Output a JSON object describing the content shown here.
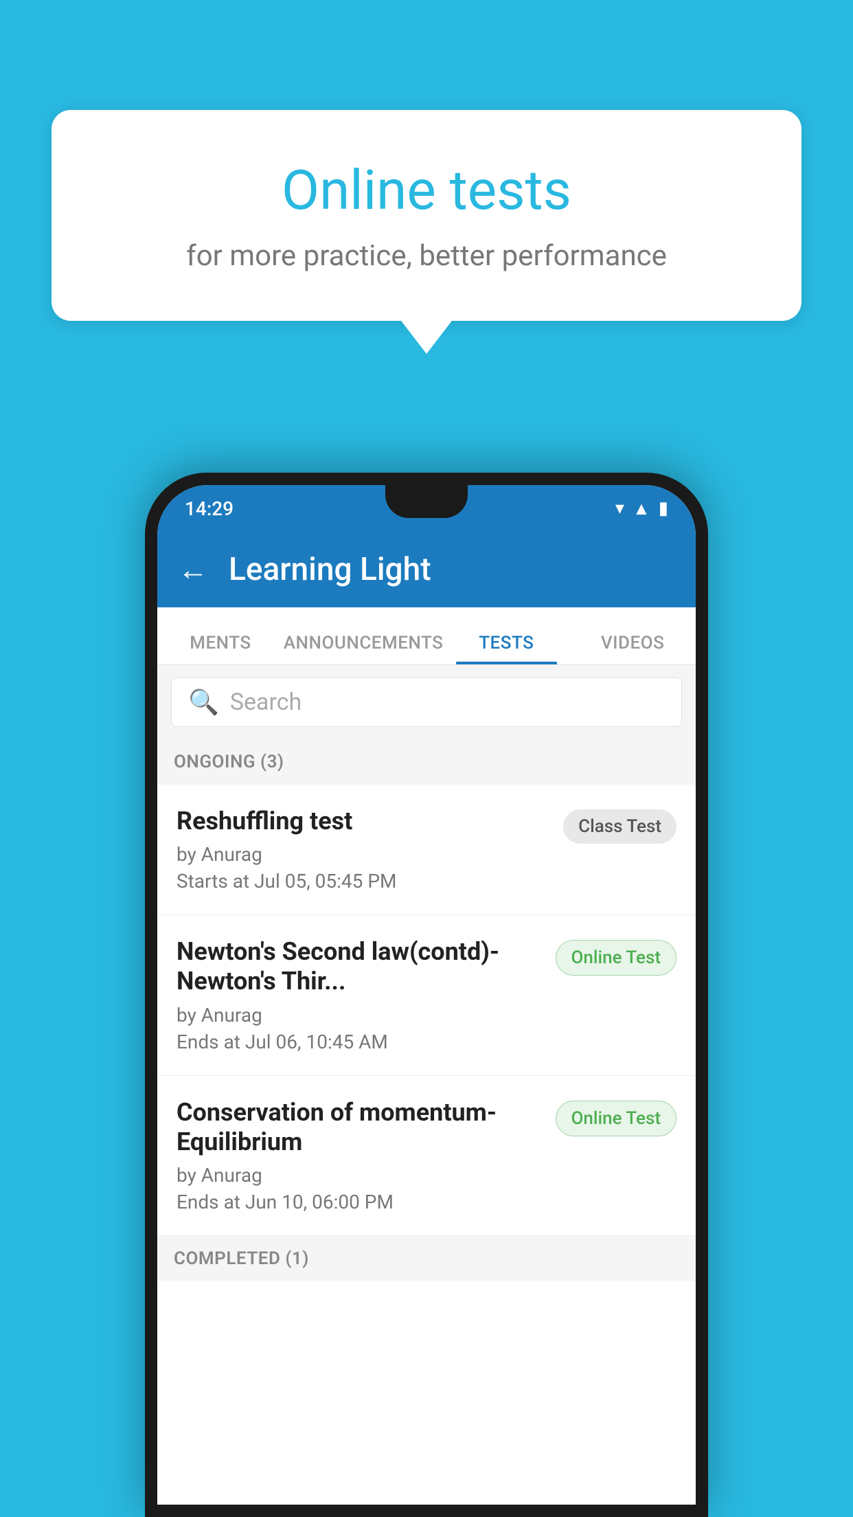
{
  "background_color": "#29b8e0",
  "bubble": {
    "title": "Online tests",
    "subtitle": "for more practice, better performance"
  },
  "phone": {
    "status_bar": {
      "time": "14:29",
      "icons": [
        "wifi",
        "signal",
        "battery"
      ]
    },
    "app_bar": {
      "title": "Learning Light",
      "back_label": "←"
    },
    "tabs": [
      {
        "label": "MENTS",
        "active": false
      },
      {
        "label": "ANNOUNCEMENTS",
        "active": false
      },
      {
        "label": "TESTS",
        "active": true
      },
      {
        "label": "VIDEOS",
        "active": false
      }
    ],
    "search": {
      "placeholder": "Search"
    },
    "sections": [
      {
        "header": "ONGOING (3)",
        "items": [
          {
            "name": "Reshuffling test",
            "by": "by Anurag",
            "time": "Starts at  Jul 05, 05:45 PM",
            "badge": "Class Test",
            "badge_type": "class"
          },
          {
            "name": "Newton's Second law(contd)-Newton's Thir...",
            "by": "by Anurag",
            "time": "Ends at  Jul 06, 10:45 AM",
            "badge": "Online Test",
            "badge_type": "online"
          },
          {
            "name": "Conservation of momentum-Equilibrium",
            "by": "by Anurag",
            "time": "Ends at  Jun 10, 06:00 PM",
            "badge": "Online Test",
            "badge_type": "online"
          }
        ]
      }
    ],
    "completed_header": "COMPLETED (1)"
  }
}
